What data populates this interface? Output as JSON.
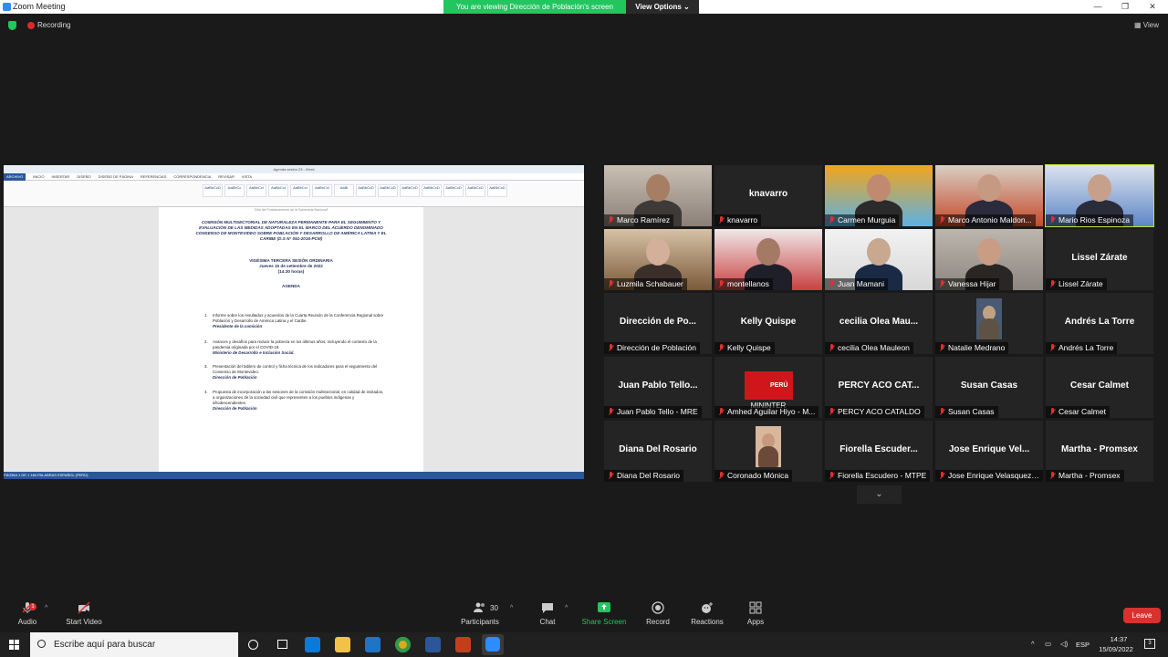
{
  "window": {
    "title": "Zoom Meeting",
    "minimize": "—",
    "restore": "❐",
    "close": "✕"
  },
  "banner": {
    "text": "You are viewing Dirección de Población's screen",
    "view_options": "View Options ⌄"
  },
  "topbar": {
    "recording": "Recording",
    "view": "View"
  },
  "shared_doc": {
    "title": "Agenda sesión 23 - Word",
    "tabs": [
      "ARCHIVO",
      "INICIO",
      "INSERTAR",
      "DISEÑO",
      "DISEÑO DE PÁGINA",
      "REFERENCIAS",
      "CORRESPONDENCIA",
      "REVISAR",
      "VISTA"
    ],
    "styles": [
      "AaBbCcD",
      "AaBbCc",
      "AaBbCcI",
      "AaBbCcI",
      "AaBbCcI",
      "AaBbCcI",
      "AaBl",
      "AaBbCcD",
      "AaBbCcD",
      "AaBbCcD",
      "AaBbCcD",
      "AaBbCcD",
      "AaBbCcD",
      "AaBbCcD"
    ],
    "motto": "\"Año del Fortalecimiento de la Soberanía Nacional\"",
    "heading": "COMISIÓN MULTISECTORIAL DE NATURALEZA PERMANENTE PARA EL SEGUIMIENTO Y EVALUACIÓN DE LAS MEDIDAS ADOPTADAS EN EL MARCO DEL ACUERDO DENOMINADO CONSENSO DE MONTEVIDEO SOBRE POBLACIÓN Y DESARROLLO DE AMÉRICA LATINA Y EL CARIBE (D.S N° 051-2016-PCM)",
    "session": "VIGÉSIMA TERCERA SESIÓN ORDINARIA",
    "date": "Jueves 15 de setiembre de 2022",
    "time": "(14:30 horas)",
    "agenda_label": "AGENDA",
    "items": [
      {
        "num": "1.",
        "text": "Informe sobre los resultados y acuerdos de la Cuarta Reunión de la Conferencia Regional sobre Población y Desarrollo de América Latina y el Caribe.",
        "who": "Presidente de la comisión"
      },
      {
        "num": "2.",
        "text": "Avances y desafíos para reducir la pobreza en los últimos años, incluyendo el contexto de la pandemia originada por el COVID-19.",
        "who": "Ministerio de Desarrollo e Inclusión Social."
      },
      {
        "num": "3.",
        "text": "Presentación del tablero de control y ficha técnica de los indicadores para el seguimiento del Consenso de Montevideo.",
        "who": "Dirección de Población"
      },
      {
        "num": "4.",
        "text": "Propuesta de incorporación a las sesiones de la comisión multisectorial, en calidad de invitados, a organizaciones de la sociedad civil que representen a los pueblos indígenas y afrodescendientes.",
        "who": "Dirección de Población"
      }
    ],
    "status": "PÁGINA 1 DE 1    184 PALABRAS    ESPAÑOL (PERÚ)"
  },
  "participants": [
    {
      "label": "Marco Ramírez",
      "big": "",
      "video": true
    },
    {
      "label": "knavarro",
      "big": "knavarro",
      "video": false
    },
    {
      "label": "Carmen Murguia",
      "big": "",
      "video": true
    },
    {
      "label": "Marco Antonio Maldon...",
      "big": "",
      "video": true
    },
    {
      "label": "Mario Rios Espinoza",
      "big": "",
      "video": true,
      "active": true
    },
    {
      "label": "Luzmila Schabauer",
      "big": "",
      "video": true
    },
    {
      "label": "montellanos",
      "big": "",
      "video": true
    },
    {
      "label": "Juan Mamani",
      "big": "",
      "video": true
    },
    {
      "label": "Vanessa Hijar",
      "big": "",
      "video": true
    },
    {
      "label": "Lissel Zárate",
      "big": "Lissel Zárate",
      "video": false
    },
    {
      "label": "Dirección de Población",
      "big": "Dirección de Po...",
      "video": false
    },
    {
      "label": "Kelly Quispe",
      "big": "Kelly Quispe",
      "video": false
    },
    {
      "label": "cecilia Olea Mauleon",
      "big": "cecilia Olea Mau...",
      "video": false
    },
    {
      "label": "Natalie Medrano",
      "big": "",
      "video": true
    },
    {
      "label": "Andrés La Torre",
      "big": "Andrés La Torre",
      "video": false
    },
    {
      "label": "Juan Pablo Tello - MRE",
      "big": "Juan Pablo Tello...",
      "video": false
    },
    {
      "label": "Amhed Aguilar Hiyo - M...",
      "big": "",
      "video": true,
      "logo": "PERÚ",
      "logo_sub": "MININTER"
    },
    {
      "label": "PERCY ACO CATALDO",
      "big": "PERCY ACO CAT...",
      "video": false
    },
    {
      "label": "Susan Casas",
      "big": "Susan Casas",
      "video": false
    },
    {
      "label": "Cesar Calmet",
      "big": "Cesar Calmet",
      "video": false
    },
    {
      "label": "Diana Del Rosario",
      "big": "Diana Del Rosario",
      "video": false
    },
    {
      "label": "Coronado Mónica",
      "big": "",
      "video": true
    },
    {
      "label": "Fiorella Escudero - MTPE",
      "big": "Fiorella Escuder...",
      "video": false
    },
    {
      "label": "Jose Enrique Velasquez ...",
      "big": "Jose Enrique Vel...",
      "video": false
    },
    {
      "label": "Martha - Promsex",
      "big": "Martha - Promsex",
      "video": false
    }
  ],
  "toolbar": {
    "audio": "Audio",
    "audio_badge": "1",
    "start_video": "Start Video",
    "participants": "Participants",
    "participants_count": "30",
    "chat": "Chat",
    "share": "Share Screen",
    "record": "Record",
    "reactions": "Reactions",
    "apps": "Apps",
    "leave": "Leave"
  },
  "taskbar": {
    "search_placeholder": "Escribe aquí para buscar",
    "lang": "ESP",
    "time": "14:37",
    "date": "15/09/2022",
    "notif_count": "3"
  },
  "colors": {
    "share_green": "#22c55e",
    "active_speaker": "#c4e03a",
    "leave_red": "#d9322e",
    "word_blue": "#2b579a"
  }
}
